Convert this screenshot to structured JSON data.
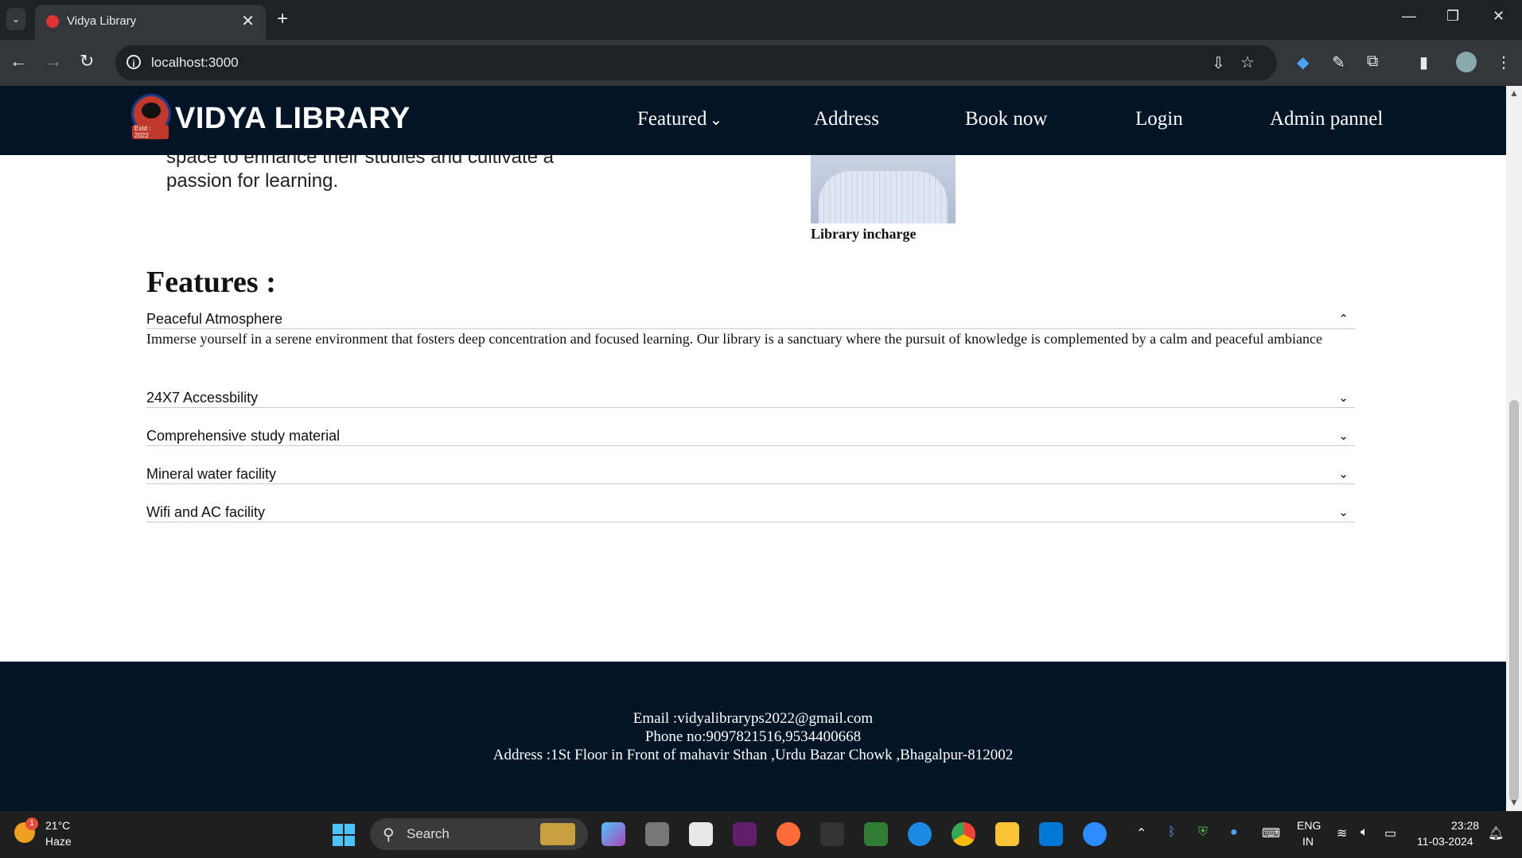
{
  "browser": {
    "tab_title": "Vidya Library",
    "tab_close": "✕",
    "new_tab": "+",
    "url": "localhost:3000",
    "window_controls": [
      "—",
      "❐",
      "✕"
    ]
  },
  "site": {
    "brand": "VIDYA LIBRARY",
    "logo_text": "Estd : 2022",
    "nav": {
      "featured": "Featured",
      "address": "Address",
      "book_now": "Book now",
      "login": "Login",
      "admin": "Admin pannel"
    },
    "mission_text": "to be a haven for students seeking a quiet, focuse space to enhance their studies and cultivate a passion for learning.",
    "incharge_caption": "Library incharge",
    "features_heading": "Features :",
    "features": [
      {
        "title": "Peaceful Atmosphere",
        "expanded": true,
        "body": "Immerse yourself in a serene environment that fosters deep concentration and focused learning. Our library is a sanctuary where the pursuit of knowledge is complemented by a calm and peaceful ambiance"
      },
      {
        "title": "24X7 Accessbility",
        "expanded": false
      },
      {
        "title": "Comprehensive study material",
        "expanded": false
      },
      {
        "title": "Mineral water facility",
        "expanded": false
      },
      {
        "title": "Wifi and AC facility",
        "expanded": false
      }
    ],
    "footer": {
      "email": "Email :vidyalibraryps2022@gmail.com",
      "phone": "Phone no:9097821516,9534400668",
      "address": "Address :1St Floor in Front of mahavir Sthan ,Urdu Bazar Chowk ,Bhagalpur-812002"
    }
  },
  "taskbar": {
    "weather_temp": "21°C",
    "weather_cond": "Haze",
    "weather_badge": "1",
    "search_label": "Search",
    "lang_top": "ENG",
    "lang_bottom": "IN",
    "time": "23:28",
    "date": "11-03-2024"
  },
  "colors": {
    "nav_bg": "#031426",
    "footer_bg": "#031426",
    "chrome_dark": "#202124"
  }
}
